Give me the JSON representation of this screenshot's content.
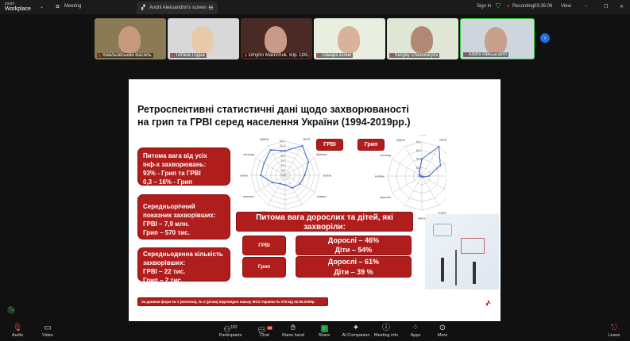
{
  "app": {
    "brand_top": "zoom",
    "brand_bottom": "Workplace",
    "meeting_label": "Meeting",
    "share_tab": "Andrii Aleksandrin's screen",
    "sign_in": "Sign in",
    "recording": "Recording",
    "timer": "03:35:06",
    "view": "View"
  },
  "participants": [
    {
      "name": "Хмельовський Василь",
      "bg": "#8a7a55",
      "face": "#c79a80"
    },
    {
      "name": "Тетяна Годна",
      "bg": "#d8d8d8",
      "face": "#e8c9a8"
    },
    {
      "name": "Dmytro Malinchuk. Юр. ОХОР...",
      "bg": "#4a2a25",
      "face": "#c99a88"
    },
    {
      "name": "Тамара Білик",
      "bg": "#e8efe0",
      "face": "#d8b39a"
    },
    {
      "name": "Sergey Chebotaryov",
      "bg": "#dfe6d6",
      "face": "#b28875"
    },
    {
      "name": "Andrii Aleksandrin",
      "bg": "#cfd5dc",
      "face": "#c6a08a"
    }
  ],
  "slide": {
    "title_line1": "Ретроспективні статистичні дані щодо захворюваності",
    "title_line2": "на грип та ГРВІ серед населення України (1994-2019рр.)",
    "box1": [
      "Питома вага від усіх",
      "інф-х захворювань:",
      "93% -  Грип та ГРВІ",
      "0,3 – 16% - Грип"
    ],
    "box2": [
      "Середньорічний",
      "показник захворівших:",
      "ГРВІ – 7,9 млн.",
      "Грип – 570 тис."
    ],
    "box3": [
      "Середньоденна кількість",
      "захворівших:",
      "ГРВІ – 22 тис.",
      "Грип – 2 тис."
    ],
    "label_grvi": "ГРВІ",
    "label_flu": "Грип",
    "share_header": "Питома вага дорослих та дітей, які захворіли:",
    "row_grvi": "ГРВІ",
    "grvi_adults": "Дорослі – 46%",
    "grvi_children": "Діти – 54%",
    "row_flu": "Грип",
    "flu_adults": "Дорослі – 61%",
    "flu_children": "Діти – 39 %",
    "footnote": "За даними форм № 1 (місячна), № 2 (річна) відповідно наказу МОЗ України № 378 від 02.06.2009р."
  },
  "chart_data": [
    {
      "type": "radar",
      "title": "ГРВІ",
      "categories": [
        "січень",
        "лютий",
        "березень",
        "квітень",
        "травень",
        "червень",
        "липень",
        "серпень",
        "вересень",
        "жовтень",
        "листопад",
        "грудень"
      ],
      "values": [
        10,
        14,
        11,
        8,
        7,
        6,
        4,
        4,
        6,
        10,
        10,
        12
      ],
      "rlim": [
        0,
        14
      ],
      "ticks": [
        "0,0",
        "2,0",
        "4,0",
        "6,0",
        "8,0",
        "10,0",
        "12,0",
        "14,0"
      ],
      "color": "#3b63c4"
    },
    {
      "type": "radar",
      "title": "Грип",
      "categories": [
        "січень",
        "лютий",
        "березень",
        "квітень",
        "травень",
        "червень",
        "липень",
        "серпень",
        "вересень",
        "жовтень",
        "листопад",
        "грудень"
      ],
      "values": [
        20,
        40,
        25,
        8,
        2,
        1,
        0.5,
        0.5,
        1,
        2,
        3,
        6
      ],
      "rlim": [
        0,
        40
      ],
      "ticks": [
        "0,0",
        "10,0",
        "20,0",
        "30,0",
        "40,0"
      ],
      "color": "#3b63c4"
    }
  ],
  "toolbar": {
    "audio": "Audio",
    "video": "Video",
    "participants": "Participants",
    "participants_count": "152",
    "chat": "Chat",
    "chat_badge": "14",
    "raise_hand": "Raise hand",
    "share": "Share",
    "ai": "AI Companion",
    "info": "Meeting info",
    "apps": "Apps",
    "more": "More",
    "leave": "Leave"
  }
}
